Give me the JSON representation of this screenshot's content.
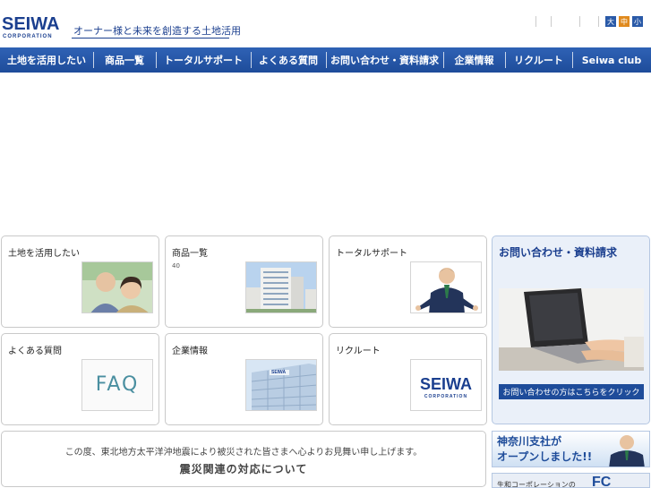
{
  "header": {
    "logo_text": "SEIWA",
    "logo_sub": "CORPORATION",
    "tagline": "オーナー様と未来を創造する土地活用",
    "font_sizes": [
      {
        "label": "大",
        "active": false
      },
      {
        "label": "中",
        "active": true
      },
      {
        "label": "小",
        "active": false
      }
    ]
  },
  "nav": {
    "items": [
      {
        "label": "土地を活用したい"
      },
      {
        "label": "商品一覧"
      },
      {
        "label": "トータルサポート"
      },
      {
        "label": "よくある質問"
      },
      {
        "label": "お問い合わせ・資料請求"
      },
      {
        "label": "企業情報"
      },
      {
        "label": "リクルート"
      },
      {
        "label": "Seiwa club"
      }
    ]
  },
  "panels": {
    "land": {
      "label": "土地を活用したい"
    },
    "products": {
      "label": "商品一覧",
      "sub": "40"
    },
    "support": {
      "label": "トータルサポート"
    },
    "faq": {
      "label": "よくある質問",
      "thumb_text": "FAQ"
    },
    "company": {
      "label": "企業情報",
      "sign_text": "SEIWA"
    },
    "recruit": {
      "label": "リクルート",
      "logo_text": "SEIWA",
      "logo_sub": "CORPORATION"
    }
  },
  "contact": {
    "title": "お問い合わせ・資料請求",
    "button": "お問い合わせの方はこちらをクリック"
  },
  "quake": {
    "line1": "この度、東北地方太平洋沖地震により被災された皆さまへ心よりお見舞い申し上げます。",
    "line2": "震災関連の対応について"
  },
  "banners": {
    "kanagawa_line1": "神奈川支社が",
    "kanagawa_line2": "オープンしました!!",
    "fc_text": "生和コーポレーションの",
    "fc_mark": "FC"
  },
  "colors": {
    "brand": "#1b3f8f",
    "nav": "#1e4c9a",
    "accent_orange": "#e08a1e"
  }
}
